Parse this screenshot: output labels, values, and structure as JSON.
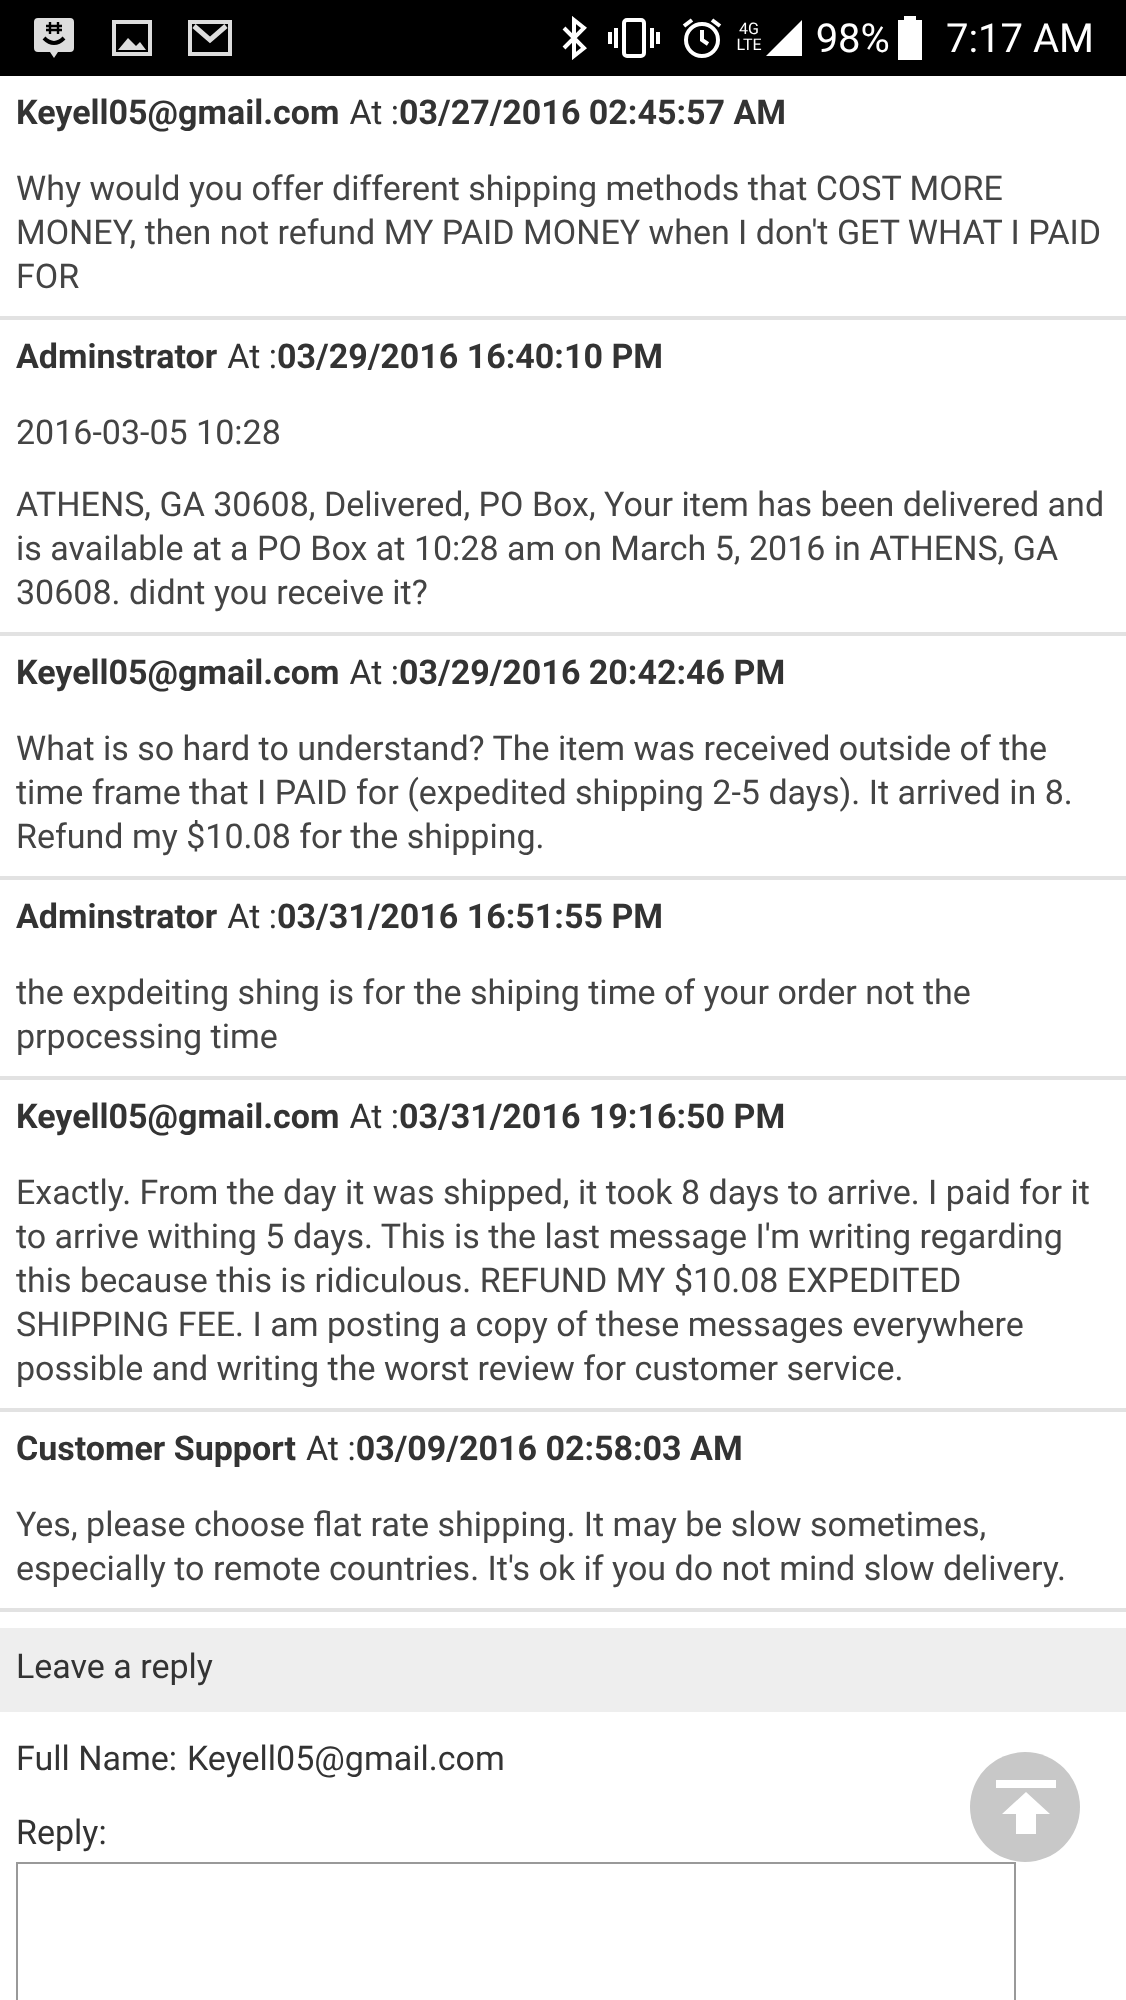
{
  "status_bar": {
    "network_top": "4G",
    "network_bottom": "LTE",
    "battery": "98%",
    "time": "7:17 AM"
  },
  "messages": [
    {
      "author": "Keyell05@gmail.com",
      "at_label": "At :",
      "date": "03/27/2016 02:45:57 AM",
      "paragraphs": [
        "Why would you offer different shipping methods that COST MORE MONEY, then not refund MY PAID MONEY when I don't GET WHAT I PAID FOR"
      ]
    },
    {
      "author": "Adminstrator",
      "at_label": "At :",
      "date": "03/29/2016 16:40:10 PM",
      "paragraphs": [
        "2016-03-05 10:28",
        "ATHENS, GA 30608, Delivered, PO Box, Your item has been delivered and is available at a PO Box at 10:28 am on March 5, 2016 in ATHENS, GA 30608. didnt you receive it?"
      ]
    },
    {
      "author": "Keyell05@gmail.com",
      "at_label": "At :",
      "date": "03/29/2016 20:42:46 PM",
      "paragraphs": [
        "What is so hard to understand? The item was received outside of the time frame that I PAID for (expedited shipping 2-5 days). It arrived in 8. Refund my $10.08 for the shipping."
      ]
    },
    {
      "author": "Adminstrator",
      "at_label": "At :",
      "date": "03/31/2016 16:51:55 PM",
      "paragraphs": [
        "the expdeiting shing is for the shiping time of your order not the prpocessing time"
      ]
    },
    {
      "author": "Keyell05@gmail.com",
      "at_label": "At :",
      "date": "03/31/2016 19:16:50 PM",
      "paragraphs": [
        "Exactly. From the day it was shipped, it took 8 days to arrive. I paid for it to arrive withing 5 days. This is the last message I'm writing regarding this because this is ridiculous. REFUND MY $10.08 EXPEDITED SHIPPING FEE. I am posting a copy of these messages everywhere possible and writing the worst review for customer service."
      ]
    },
    {
      "author": "Customer Support",
      "at_label": "At :",
      "date": "03/09/2016 02:58:03 AM",
      "paragraphs": [
        "Yes, please choose flat rate shipping. It may be slow sometimes, especially to remote countries. It's ok if you do not mind slow delivery."
      ]
    }
  ],
  "reply": {
    "heading": "Leave a reply",
    "full_name_label": "Full Name:",
    "full_name": "Keyell05@gmail.com",
    "reply_label": "Reply:"
  }
}
